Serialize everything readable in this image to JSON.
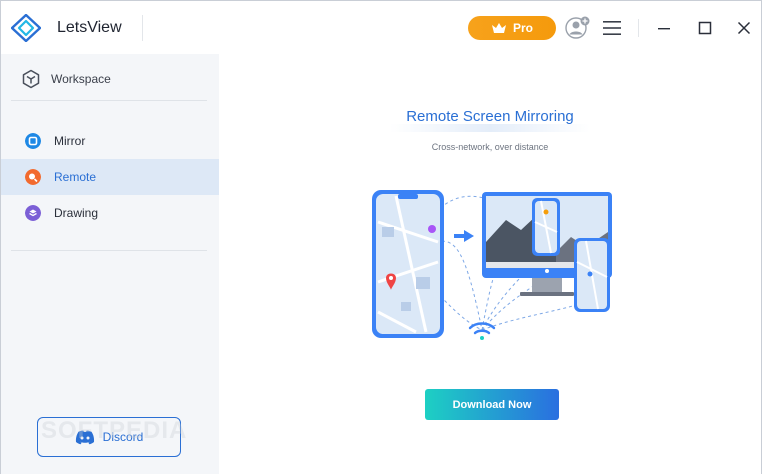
{
  "app": {
    "title": "LetsView"
  },
  "titlebar": {
    "pro_label": "Pro"
  },
  "sidebar": {
    "workspace_label": "Workspace",
    "items": [
      {
        "label": "Mirror",
        "color": "#1e88e5"
      },
      {
        "label": "Remote",
        "color": "#f26a2e"
      },
      {
        "label": "Drawing",
        "color": "#7b5fd6"
      }
    ],
    "active_index": 1,
    "discord_label": "Discord"
  },
  "main": {
    "title": "Remote Screen Mirroring",
    "subtitle": "Cross-network, over distance",
    "download_label": "Download Now"
  },
  "watermark": "SOFTPEDIA",
  "colors": {
    "accent": "#2a6fd4",
    "pro": "#f7a21b",
    "sidebar_bg": "#f4f6f9",
    "active_bg": "#dde8f6"
  }
}
